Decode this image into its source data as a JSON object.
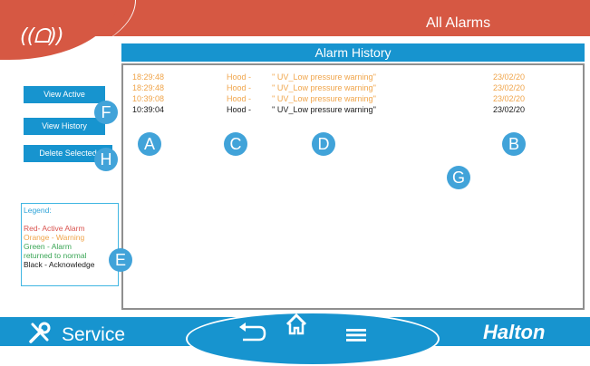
{
  "header": {
    "page_title": "All Alarms",
    "logo_icon": "alarm-bell-icon",
    "colors": {
      "bar": "#d65843",
      "accent": "#1794cf"
    }
  },
  "alarm_history": {
    "title": "Alarm History",
    "rows": [
      {
        "time": "18:29:48",
        "source": "Hood -",
        "message": "'' UV_Low pressure warning''",
        "date": "23/02/20",
        "color": "#f0a54b"
      },
      {
        "time": "18:29:48",
        "source": "Hood -",
        "message": "'' UV_Low pressure warning''",
        "date": "23/02/20",
        "color": "#f0a54b"
      },
      {
        "time": "10:39:08",
        "source": "Hood -",
        "message": "'' UV_Low pressure warning''",
        "date": "23/02/20",
        "color": "#f0a54b"
      },
      {
        "time": "10:39:04",
        "source": "Hood -",
        "message": "'' UV_Low pressure warning''",
        "date": "23/02/20",
        "color": "#1a1a1a"
      }
    ]
  },
  "buttons": {
    "view_active": "View Active",
    "view_history": "View History",
    "delete_selected": "Delete Selected"
  },
  "legend": {
    "title": "Legend:",
    "red": "Red- Active Alarm",
    "orange": "Orange - Warning",
    "green_1": "Green - Alarm",
    "green_2": "returned to normal",
    "black": "Black - Acknowledge",
    "colors": {
      "title": "#2ea3d8",
      "red": "#d9534f",
      "orange": "#f0a54b",
      "green": "#3aa656",
      "black": "#1a1a1a"
    }
  },
  "markers": {
    "a": "A",
    "b": "B",
    "c": "C",
    "d": "D",
    "e": "E",
    "f": "F",
    "g": "G",
    "h": "H"
  },
  "footer": {
    "service_label": "Service",
    "brand": "Halton",
    "icons": [
      "wrench-screwdriver-icon",
      "back-arrow-icon",
      "home-icon",
      "menu-icon"
    ]
  }
}
